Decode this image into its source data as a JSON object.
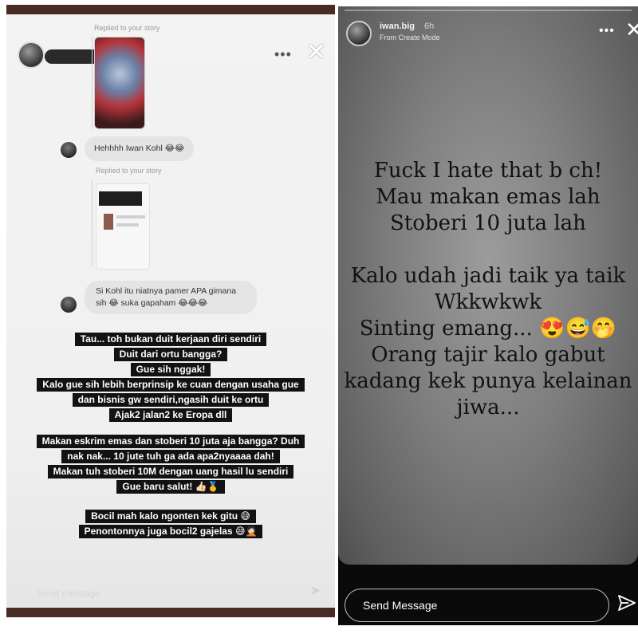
{
  "left_story": {
    "replied_label_1": "Replied to your story",
    "replied_label_2": "Replied to your story",
    "messages": [
      {
        "text": "Hehhhh Iwan Kohl 😂😂"
      },
      {
        "line1": "Si Kohl itu niatnya pamer APA gimana",
        "line2": "sih 😂 suka gapaham 😂😂😂"
      }
    ],
    "caption_block_1": [
      "Tau... toh bukan duit kerjaan diri sendiri",
      "Duit dari ortu bangga?",
      "Gue sih nggak!",
      "Kalo gue sih lebih berprinsip ke cuan dengan usaha gue",
      "dan bisnis gw sendiri,ngasih duit ke ortu",
      "Ajak2 jalan2 ke Eropa dll"
    ],
    "caption_block_2": [
      "Makan eskrim emas dan stoberi 10 juta aja bangga? Duh",
      "nak nak... 10 jute tuh ga ada apa2nyaaaa dah!",
      "Makan tuh stoberi 10M dengan uang hasil lu sendiri",
      "Gue baru salut! 👍🏻🥇"
    ],
    "caption_block_3": [
      "Bocil mah kalo ngonten kek gitu 😅",
      "Penontonnya juga bocil2 gajelas 😅🤦🏻"
    ],
    "send_placeholder": "Send message"
  },
  "right_story": {
    "username": "iwan.big",
    "time": "6h",
    "subtitle": "From Create Mode",
    "text_lines": [
      "Fuck I hate that b   ch!",
      "Mau makan emas lah",
      "Stoberi 10 juta lah",
      "",
      "Kalo udah jadi taik ya taik",
      "Wkkwkwk",
      "Sinting emang... 😍😅🤭",
      "Orang tajir kalo gabut",
      "kadang kek punya kelainan",
      "jiwa..."
    ],
    "send_placeholder": "Send Message"
  },
  "icons": {
    "more": "more-horizontal-icon",
    "close": "close-icon",
    "send": "send-paper-plane-icon"
  },
  "colors": {
    "caption_bg": "#121212",
    "caption_fg": "#ffffff",
    "right_card_bg": "#8a8a8a",
    "frame_strip": "#4a2a24"
  }
}
